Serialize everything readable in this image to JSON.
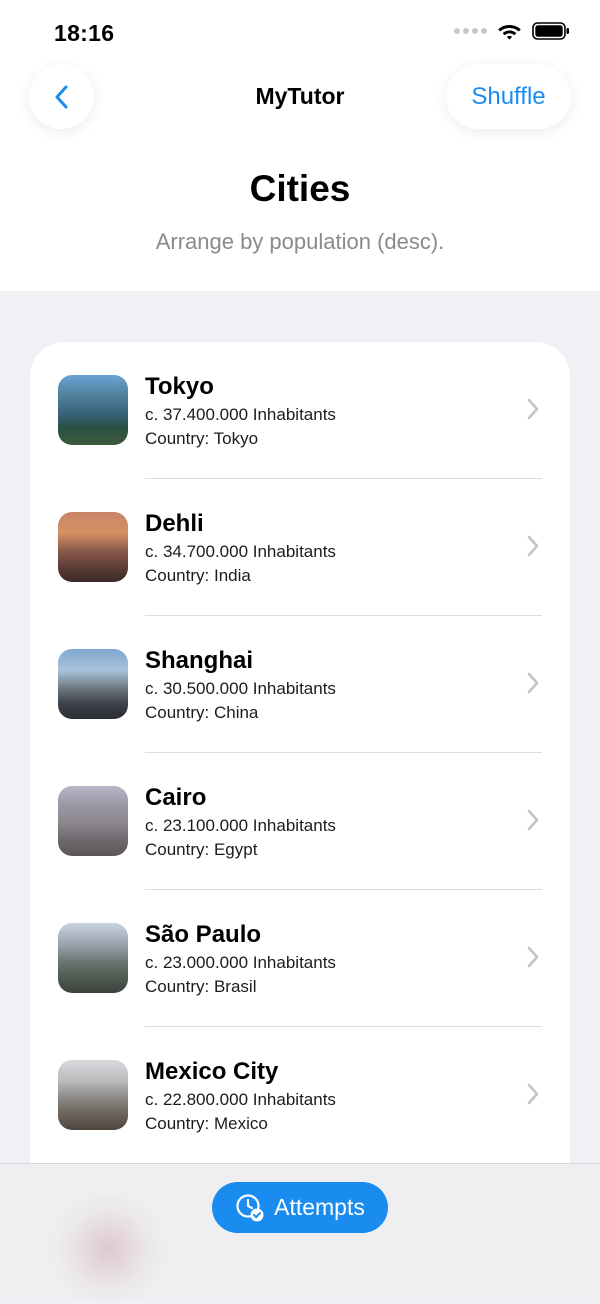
{
  "status_bar": {
    "time": "18:16",
    "icons": [
      "signal-dots-icon",
      "wifi-icon",
      "battery-icon"
    ]
  },
  "nav": {
    "back_icon": "chevron-left-icon",
    "title": "MyTutor",
    "shuffle_label": "Shuffle"
  },
  "header": {
    "title": "Cities",
    "subtitle": "Arrange by population (desc)."
  },
  "cities": [
    {
      "name": "Tokyo",
      "population": "c. 37.400.000 Inhabitants",
      "country": "Country: Tokyo",
      "thumbnail": "tokyo-photo"
    },
    {
      "name": "Dehli",
      "population": "c. 34.700.000 Inhabitants",
      "country": "Country: India",
      "thumbnail": "dehli-photo"
    },
    {
      "name": "Shanghai",
      "population": "c. 30.500.000 Inhabitants",
      "country": "Country: China",
      "thumbnail": "shanghai-photo"
    },
    {
      "name": "Cairo",
      "population": "c. 23.100.000 Inhabitants",
      "country": "Country: Egypt",
      "thumbnail": "cairo-photo"
    },
    {
      "name": "São Paulo",
      "population": "c. 23.000.000 Inhabitants",
      "country": "Country: Brasil",
      "thumbnail": "sao-paulo-photo"
    },
    {
      "name": "Mexico City",
      "population": "c. 22.800.000 Inhabitants",
      "country": "Country: Mexico",
      "thumbnail": "mexico-city-photo"
    }
  ],
  "bottom_bar": {
    "attempts_label": "Attempts",
    "attempts_icon": "clock-check-icon"
  },
  "colors": {
    "accent": "#1a8cf0",
    "background": "#f1f1f5",
    "card": "#ffffff",
    "secondary_text": "#8a8a8e"
  }
}
